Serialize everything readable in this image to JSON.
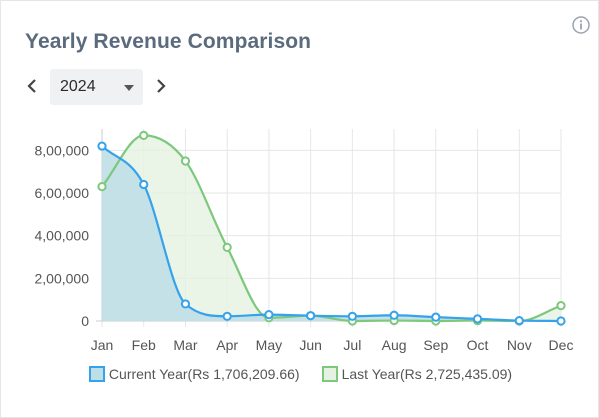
{
  "header": {
    "title": "Yearly Revenue Comparison",
    "info_icon": "info-circle-icon"
  },
  "year_selector": {
    "selected": "2024",
    "prev_icon": "chevron-left-icon",
    "next_icon": "chevron-right-icon"
  },
  "legend": {
    "current_label": "Current Year(Rs 1,706,209.66)",
    "last_label": "Last Year(Rs 2,725,435.09)"
  },
  "colors": {
    "current": "#36a2eb",
    "current_fill": "#bfdfe6",
    "last": "#7cc87c",
    "last_fill": "#e6f2e1",
    "grid": "#e6e6e6",
    "axis": "#cccccc"
  },
  "chart_data": {
    "type": "area",
    "categories": [
      "Jan",
      "Feb",
      "Mar",
      "Apr",
      "May",
      "Jun",
      "Jul",
      "Aug",
      "Sep",
      "Oct",
      "Nov",
      "Dec"
    ],
    "series": [
      {
        "name": "Current Year(Rs 1,706,209.66)",
        "values": [
          820000,
          640000,
          80000,
          22000,
          30000,
          25000,
          22000,
          27000,
          18000,
          10000,
          2000,
          0
        ]
      },
      {
        "name": "Last Year(Rs 2,725,435.09)",
        "values": [
          630000,
          870000,
          750000,
          345000,
          15000,
          25000,
          0,
          2000,
          0,
          2000,
          0,
          72000
        ]
      }
    ],
    "ylim": [
      0,
      900000
    ],
    "yticks": [
      0,
      200000,
      400000,
      600000,
      800000
    ],
    "ytick_labels": [
      "0",
      "2,00,000",
      "4,00,000",
      "6,00,000",
      "8,00,000"
    ],
    "grid": true,
    "legend_position": "bottom"
  }
}
